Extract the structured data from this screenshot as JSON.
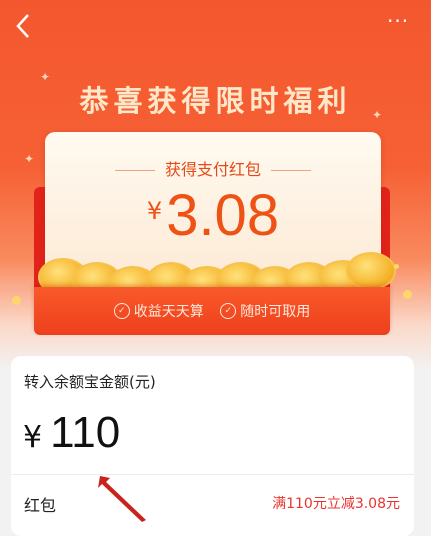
{
  "header": {
    "more_label": "···"
  },
  "hero": {
    "headline": "恭喜获得限时福利"
  },
  "card": {
    "title": "获得支付红包",
    "currency": "¥",
    "amount": "3.08"
  },
  "envelope": {
    "benefits": [
      "收益天天算",
      "随时可取用"
    ]
  },
  "form": {
    "field_label": "转入余额宝金额(元)",
    "currency": "¥",
    "amount_value": "110",
    "hongbao_label": "红包",
    "hongbao_desc": "满110元立减3.08元"
  },
  "colors": {
    "primary": "#f4572e",
    "amount": "#ee5215",
    "envelope": "#e2231a",
    "discount": "#e8342f"
  }
}
